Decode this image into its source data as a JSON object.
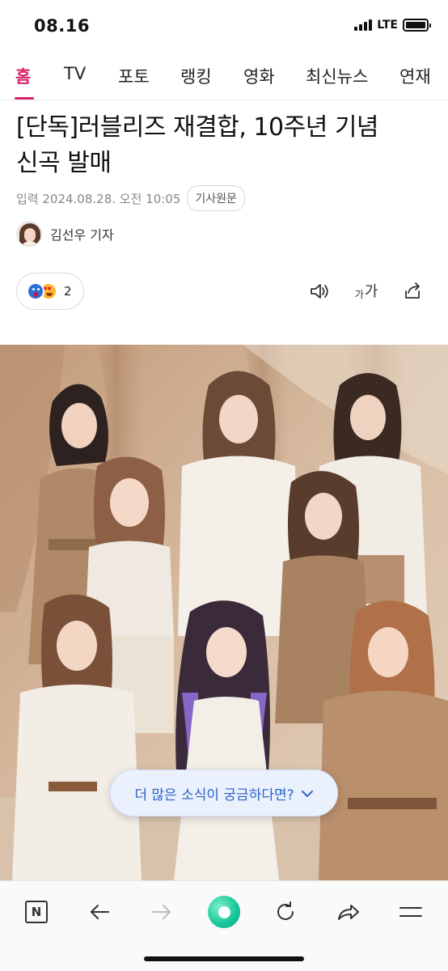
{
  "status_bar": {
    "time": "08.16",
    "network": "LTE",
    "battery_level": 1.0
  },
  "nav": {
    "tabs": [
      {
        "label": "홈",
        "active": true
      },
      {
        "label": "TV",
        "active": false
      },
      {
        "label": "포토",
        "active": false
      },
      {
        "label": "랭킹",
        "active": false
      },
      {
        "label": "영화",
        "active": false
      },
      {
        "label": "최신뉴스",
        "active": false
      },
      {
        "label": "연재",
        "active": false
      }
    ]
  },
  "article": {
    "title_line1": "[단독]러블리즈 재결합, 10주년 기념",
    "title_line2": "신곡 발매",
    "meta": "입력 2024.08.28. 오전 10:05",
    "source_button": "기사원문",
    "author": "김선우 기자",
    "reactions": {
      "icons": [
        "surprised-emoji-icon",
        "heart-eyes-emoji-icon"
      ],
      "count": "2"
    },
    "tools": [
      "speaker-icon",
      "font-size-icon",
      "share-icon"
    ],
    "font_size_label_small": "가",
    "font_size_label_large": "가"
  },
  "floating_button": {
    "label": "더 많은 소식이 궁금하다면?"
  },
  "bottom_bar": {
    "items": [
      "naver-n-icon",
      "back-arrow-icon",
      "forward-arrow-icon",
      "green-home-icon",
      "refresh-icon",
      "share-arrow-icon",
      "menu-icon"
    ],
    "n_label": "N"
  },
  "colors": {
    "accent": "#d6266b",
    "link_blue": "#2c63c6",
    "photo_backdrop": "#c9a98c"
  }
}
